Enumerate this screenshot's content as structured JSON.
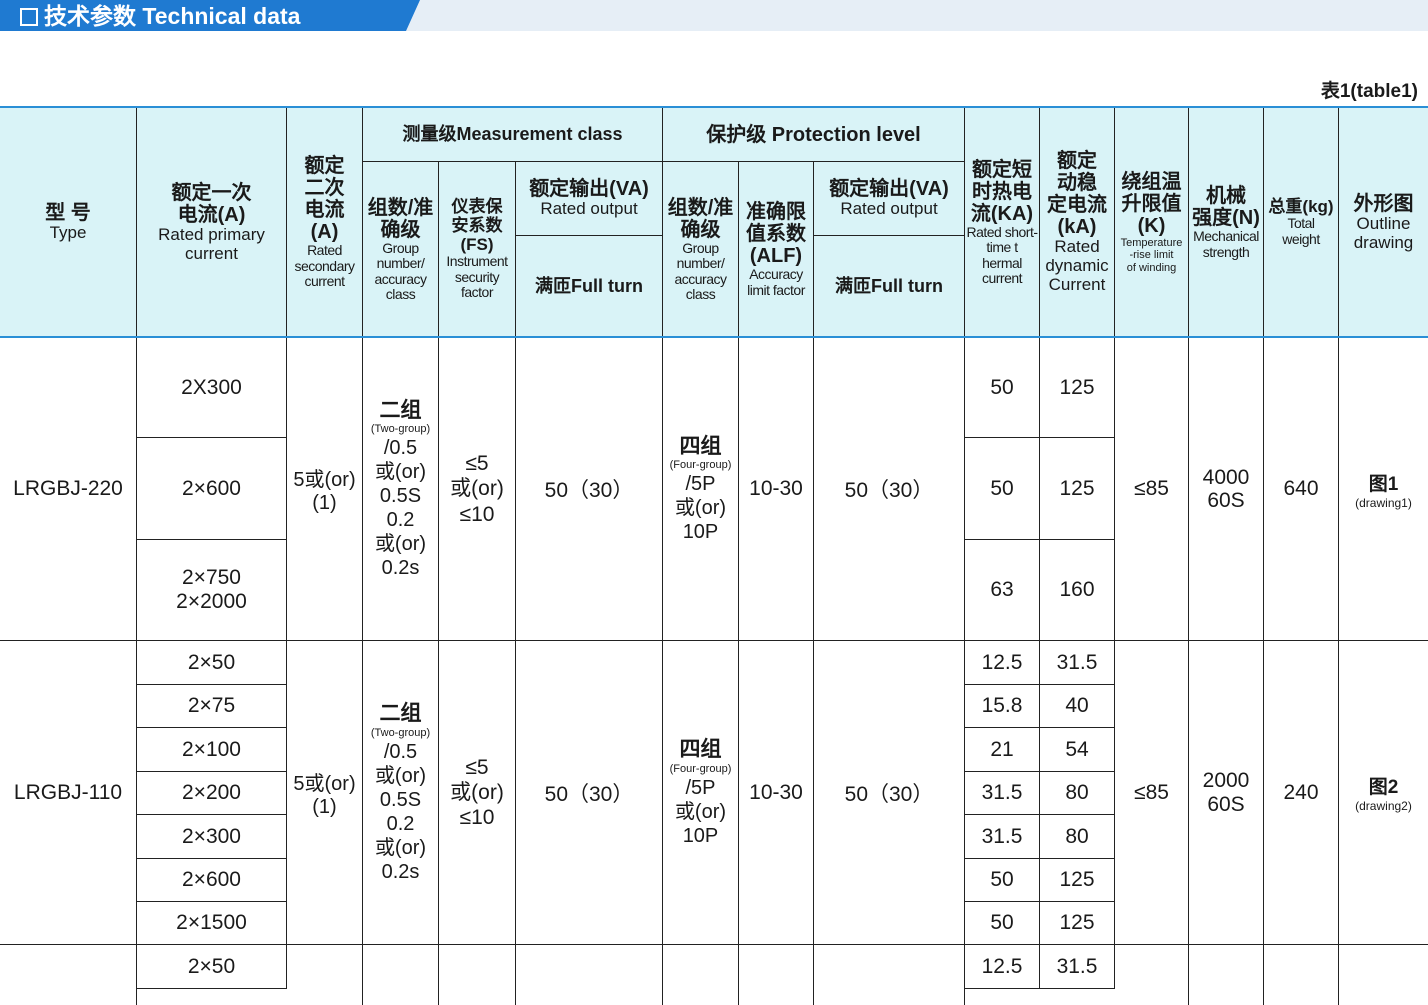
{
  "banner": {
    "title": "技术参数 Technical data"
  },
  "table_label": "表1(table1)",
  "header": {
    "type": {
      "cn": "型 号",
      "en": "Type"
    },
    "rated_primary": {
      "cn": "额定一次\n电流(A)",
      "en": "Rated primary\ncurrent"
    },
    "rated_secondary": {
      "cn": "额定\n二次\n电流\n(A)",
      "en": "Rated\nsecondary\ncurrent"
    },
    "measurement": "测量级Measurement class",
    "meas_group": {
      "cn": "组数/准\n确级",
      "en": "Group\nnumber/\naccuracy\nclass"
    },
    "meas_fs": {
      "cn": "仪表保\n安系数(FS)",
      "en": "Instrument\nsecurity\nfactor"
    },
    "meas_output": {
      "cn": "额定输出(VA)",
      "en": "Rated output"
    },
    "meas_fullturn": "满匝Full turn",
    "protection": "保护级 Protection level",
    "prot_group": {
      "cn": "组数/准\n确级",
      "en": "Group\nnumber/\naccuracy\nclass"
    },
    "prot_alf": {
      "cn": "准确限\n值系数\n(ALF)",
      "en": "Accuracy\nlimit factor"
    },
    "prot_output": {
      "cn": "额定输出(VA)",
      "en": "Rated output"
    },
    "prot_fullturn": "满匝Full turn",
    "thermal": {
      "cn": "额定短\n时热电\n流(KA)",
      "en": "Rated short-\ntime t\nhermal\ncurrent"
    },
    "dynamic": {
      "cn": "额定\n动稳\n定电流\n(kA)",
      "en": "Rated\ndynamic\nCurrent"
    },
    "temp_rise": {
      "cn": "绕组温\n升限值\n(K)",
      "en": "Temperature\n-rise limit\nof winding"
    },
    "mech": {
      "cn": "机械\n强度(N)",
      "en": "Mechanical\nstrength"
    },
    "weight": {
      "cn": "总重(kg)",
      "en": "Total\nweight"
    },
    "outline": {
      "cn": "外形图",
      "en": "Outline\ndrawing"
    }
  },
  "groups": [
    {
      "type": "LRGBJ-220",
      "secondary": "5或(or)\n(1)",
      "meas_group": {
        "main": "二组",
        "sub": "(Two-group)",
        "rest": "/0.5\n或(or)\n0.5S\n0.2\n或(or)\n0.2s"
      },
      "meas_fs": "≤5\n或(or)\n≤10",
      "meas_output": "50（30）",
      "prot_group": {
        "main": "四组",
        "sub": "(Four-group)",
        "rest": "/5P\n或(or)\n10P"
      },
      "prot_alf": "10-30",
      "prot_output": "50（30）",
      "temp_rise": "≤85",
      "mech": "4000\n60S",
      "weight": "640",
      "outline": {
        "main": "图1",
        "sub": "(drawing1)"
      },
      "rows": [
        {
          "primary": "2X300",
          "thermal": "50",
          "dynamic": "125"
        },
        {
          "primary": "2×600",
          "thermal": "50",
          "dynamic": "125"
        },
        {
          "primary": "2×750\n2×2000",
          "thermal": "63",
          "dynamic": "160"
        }
      ]
    },
    {
      "type": "LRGBJ-110",
      "secondary": "5或(or)\n(1)",
      "meas_group": {
        "main": "二组",
        "sub": "(Two-group)",
        "rest": "/0.5\n或(or)\n0.5S\n0.2\n或(or)\n0.2s"
      },
      "meas_fs": "≤5\n或(or)\n≤10",
      "meas_output": "50（30）",
      "prot_group": {
        "main": "四组",
        "sub": "(Four-group)",
        "rest": "/5P\n或(or)\n10P"
      },
      "prot_alf": "10-30",
      "prot_output": "50（30）",
      "temp_rise": "≤85",
      "mech": "2000\n60S",
      "weight": "240",
      "outline": {
        "main": "图2",
        "sub": "(drawing2)"
      },
      "rows": [
        {
          "primary": "2×50",
          "thermal": "12.5",
          "dynamic": "31.5"
        },
        {
          "primary": "2×75",
          "thermal": "15.8",
          "dynamic": "40"
        },
        {
          "primary": "2×100",
          "thermal": "21",
          "dynamic": "54"
        },
        {
          "primary": "2×200",
          "thermal": "31.5",
          "dynamic": "80"
        },
        {
          "primary": "2×300",
          "thermal": "31.5",
          "dynamic": "80"
        },
        {
          "primary": "2×600",
          "thermal": "50",
          "dynamic": "125"
        },
        {
          "primary": "2×1500",
          "thermal": "50",
          "dynamic": "125"
        }
      ]
    },
    {
      "rows": [
        {
          "primary": "2×50",
          "thermal": "12.5",
          "dynamic": "31.5"
        }
      ]
    }
  ]
}
